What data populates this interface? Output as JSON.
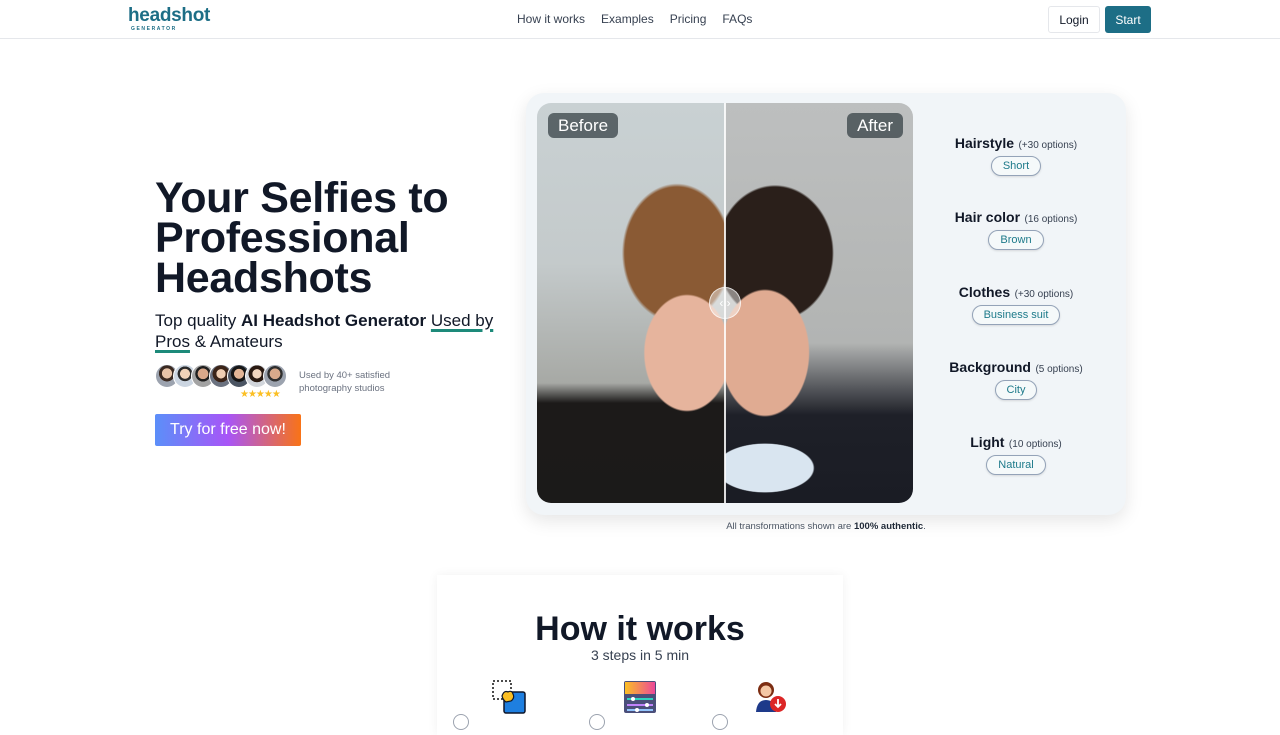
{
  "nav": {
    "logo_main": "headshot",
    "logo_sub": "GENERATOR",
    "links": [
      "How it works",
      "Examples",
      "Pricing",
      "FAQs"
    ],
    "login_label": "Login",
    "start_label": "Start"
  },
  "hero": {
    "title": "Your Selfies to Professional Headshots",
    "subtitle_prefix": "Top quality ",
    "subtitle_bold": "AI Headshot Generator",
    "subtitle_underlined_1": "Used by",
    "subtitle_underlined_2": "Pros",
    "subtitle_suffix": " & Amateurs",
    "social_proof": "Used by 40+ satisfied photography studios",
    "rating_stars": 5,
    "stars_text": "★★★★★",
    "cta_label": "Try for free now!"
  },
  "comparison": {
    "before_label": "Before",
    "after_label": "After",
    "slider_handle": "‹ ›",
    "options": [
      {
        "label": "Hairstyle",
        "count": "(+30 options)",
        "value": "Short"
      },
      {
        "label": "Hair color",
        "count": "(16 options)",
        "value": "Brown"
      },
      {
        "label": "Clothes",
        "count": "(+30 options)",
        "value": "Business suit"
      },
      {
        "label": "Background",
        "count": "(5 options)",
        "value": "City"
      },
      {
        "label": "Light",
        "count": "(10 options)",
        "value": "Natural"
      }
    ],
    "authentic_prefix": "All transformations shown are ",
    "authentic_bold": "100% authentic",
    "authentic_suffix": "."
  },
  "how_it_works": {
    "title": "How it works",
    "subtitle": "3 steps in 5 min",
    "steps": [
      {
        "icon": "select-photo-icon"
      },
      {
        "icon": "customize-sliders-icon"
      },
      {
        "icon": "download-headshot-icon"
      }
    ]
  },
  "colors": {
    "brand": "#1d6e86",
    "underline_accent": "#1d8a7a",
    "cta_gradient_start": "#5b8ff9",
    "cta_gradient_mid": "#a855f7",
    "cta_gradient_end": "#f97316",
    "star": "#fbbf24"
  }
}
